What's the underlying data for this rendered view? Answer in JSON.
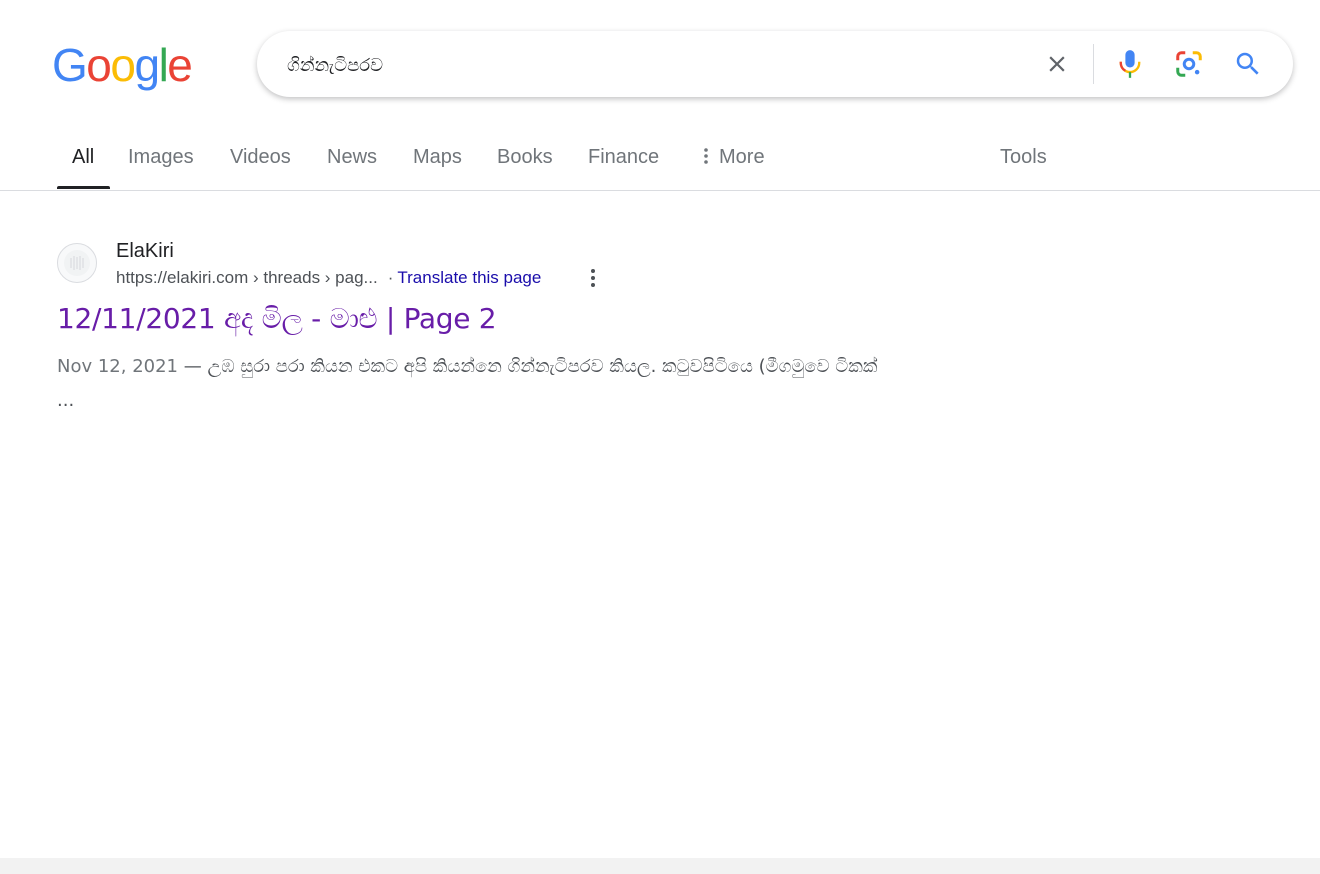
{
  "logo": {
    "letters": [
      "G",
      "o",
      "o",
      "g",
      "l",
      "e"
    ],
    "colors": [
      "#4285f4",
      "#ea4335",
      "#fbbc05",
      "#4285f4",
      "#34a853",
      "#ea4335"
    ]
  },
  "search": {
    "query": "ගින්නැටිපරව"
  },
  "tabs": {
    "all": "All",
    "images": "Images",
    "videos": "Videos",
    "news": "News",
    "maps": "Maps",
    "books": "Books",
    "finance": "Finance",
    "more": "More",
    "tools": "Tools"
  },
  "result": {
    "site_name": "ElaKiri",
    "url": "https://elakiri.com › threads › pag...",
    "translate": "Translate this page",
    "title": "12/11/2021 අද මිල - මාළු | Page 2",
    "date": "Nov 12, 2021",
    "snippet": " — උඹ සුරා පරා කියන එකට අපි කියන්නෙ ගින්නැටිපරව කියල. කටුවපිටියෙ (මීගමුවෙ ටිකක් ..."
  },
  "colors": {
    "link_visited": "#681da8",
    "link": "#1a0dab",
    "accent_blue": "#4285f4"
  }
}
